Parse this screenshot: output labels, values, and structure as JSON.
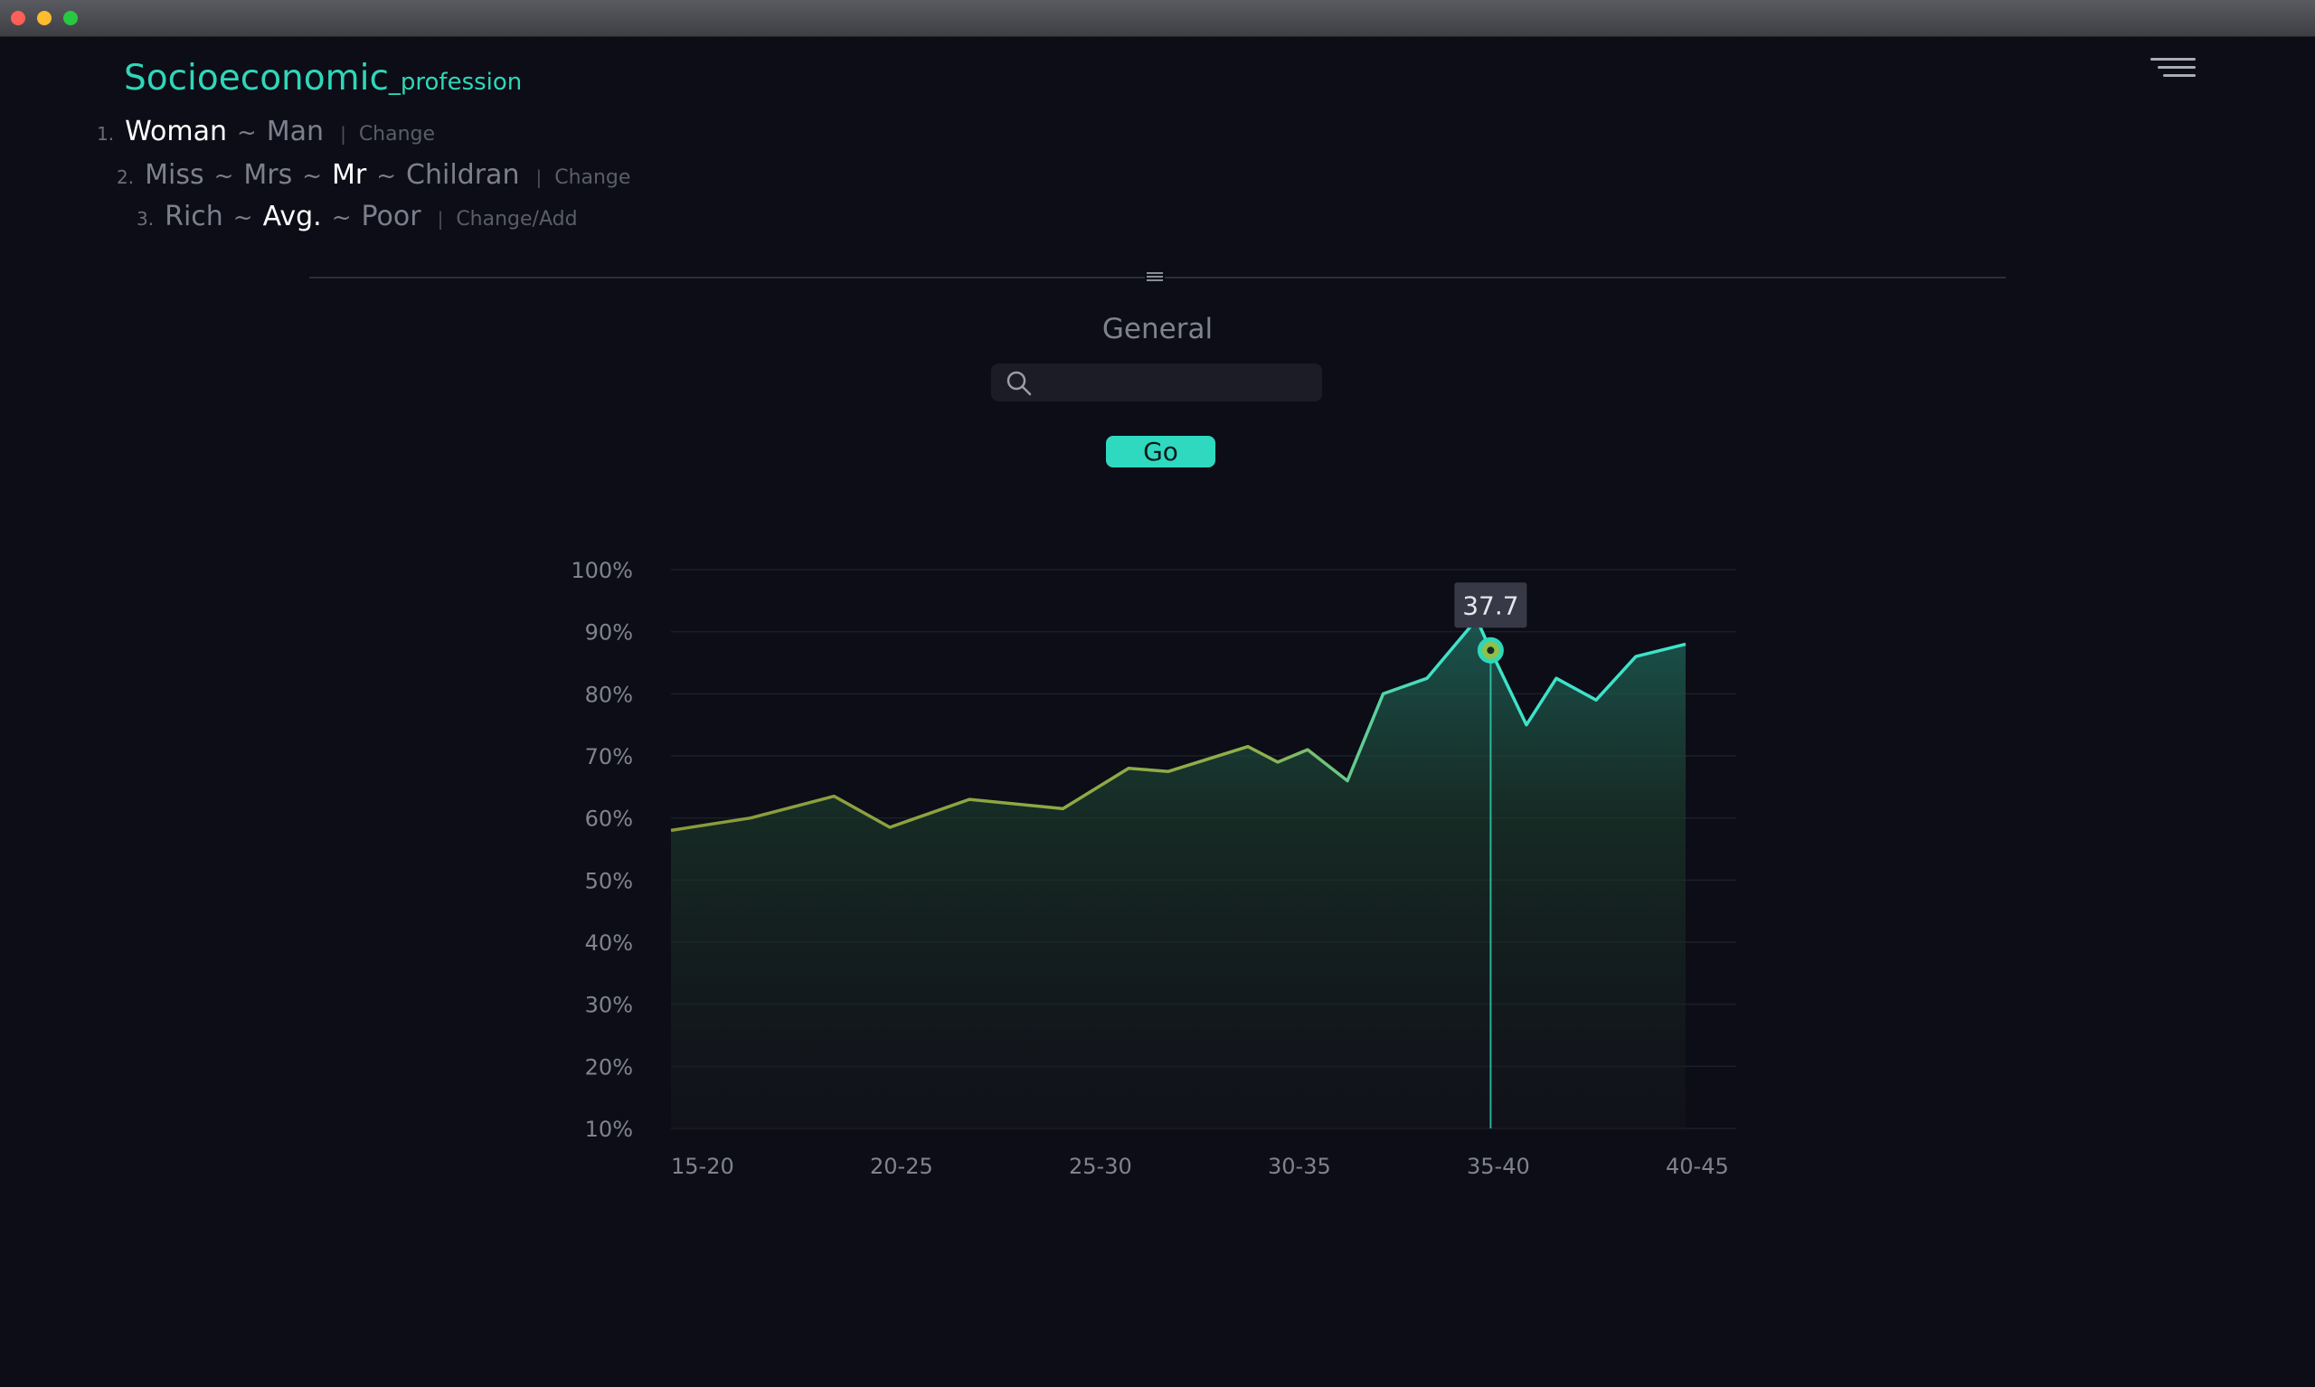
{
  "app": {
    "title": "Socioeconomic",
    "subtitle": "_profession"
  },
  "filters": [
    {
      "num": "1.",
      "options": [
        {
          "label": "Woman",
          "active": true
        },
        {
          "label": "Man",
          "active": false
        }
      ],
      "action": "Change"
    },
    {
      "num": "2.",
      "options": [
        {
          "label": "Miss",
          "active": false
        },
        {
          "label": "Mrs",
          "active": false
        },
        {
          "label": "Mr",
          "active": true
        },
        {
          "label": "Childran",
          "active": false
        }
      ],
      "action": "Change"
    },
    {
      "num": "3.",
      "options": [
        {
          "label": "Rich",
          "active": false
        },
        {
          "label": "Avg.",
          "active": true
        },
        {
          "label": "Poor",
          "active": false
        }
      ],
      "action": "Change/Add"
    }
  ],
  "separator": "~",
  "section": {
    "title": "General"
  },
  "search": {
    "placeholder": "",
    "value": ""
  },
  "go_button": {
    "label": "Go"
  },
  "colors": {
    "accent": "#2fd7b8",
    "line_start": "#8a9a3a",
    "line_end": "#3de3c9",
    "background": "#0c0d17"
  },
  "chart_data": {
    "type": "area",
    "x_tick_labels": [
      "15-20",
      "20-25",
      "25-30",
      "30-35",
      "35-40",
      "40-45"
    ],
    "ylim": [
      10,
      100
    ],
    "y_ticks": [
      10,
      20,
      30,
      40,
      50,
      60,
      70,
      80,
      90,
      100
    ],
    "y_tick_format": "%",
    "grid": true,
    "xlim": [
      0,
      5.1
    ],
    "series": [
      {
        "points": [
          [
            0.0,
            58
          ],
          [
            0.4,
            60
          ],
          [
            0.82,
            63.5
          ],
          [
            1.1,
            58.5
          ],
          [
            1.5,
            63
          ],
          [
            1.97,
            61.5
          ],
          [
            2.3,
            68
          ],
          [
            2.5,
            67.5
          ],
          [
            2.9,
            71.5
          ],
          [
            3.05,
            69
          ],
          [
            3.2,
            71
          ],
          [
            3.4,
            66
          ],
          [
            3.58,
            80
          ],
          [
            3.8,
            82.5
          ],
          [
            4.05,
            92
          ],
          [
            4.12,
            87
          ],
          [
            4.3,
            75
          ],
          [
            4.45,
            82.5
          ],
          [
            4.65,
            79
          ],
          [
            4.85,
            86
          ],
          [
            5.1,
            88
          ]
        ]
      }
    ],
    "highlight": {
      "x": 4.12,
      "y": 87,
      "label": "37.7"
    }
  }
}
